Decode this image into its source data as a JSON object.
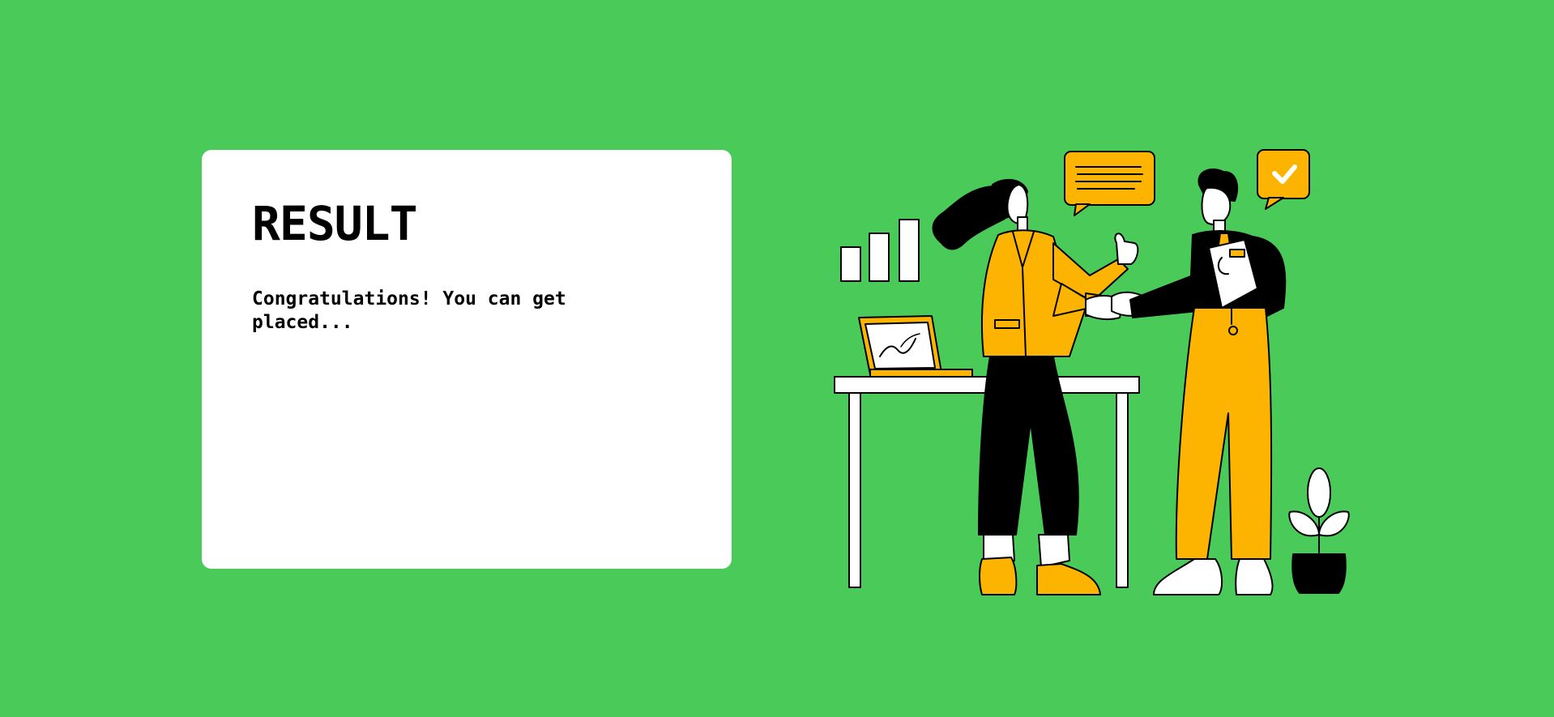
{
  "result": {
    "title": "RESULT",
    "message": "Congratulations! You can get placed..."
  },
  "colors": {
    "background": "#4ACB59",
    "card": "#FFFFFF",
    "accent": "#FDB400",
    "ink": "#000000"
  },
  "illustration": {
    "icon": "handshake-illustration"
  }
}
